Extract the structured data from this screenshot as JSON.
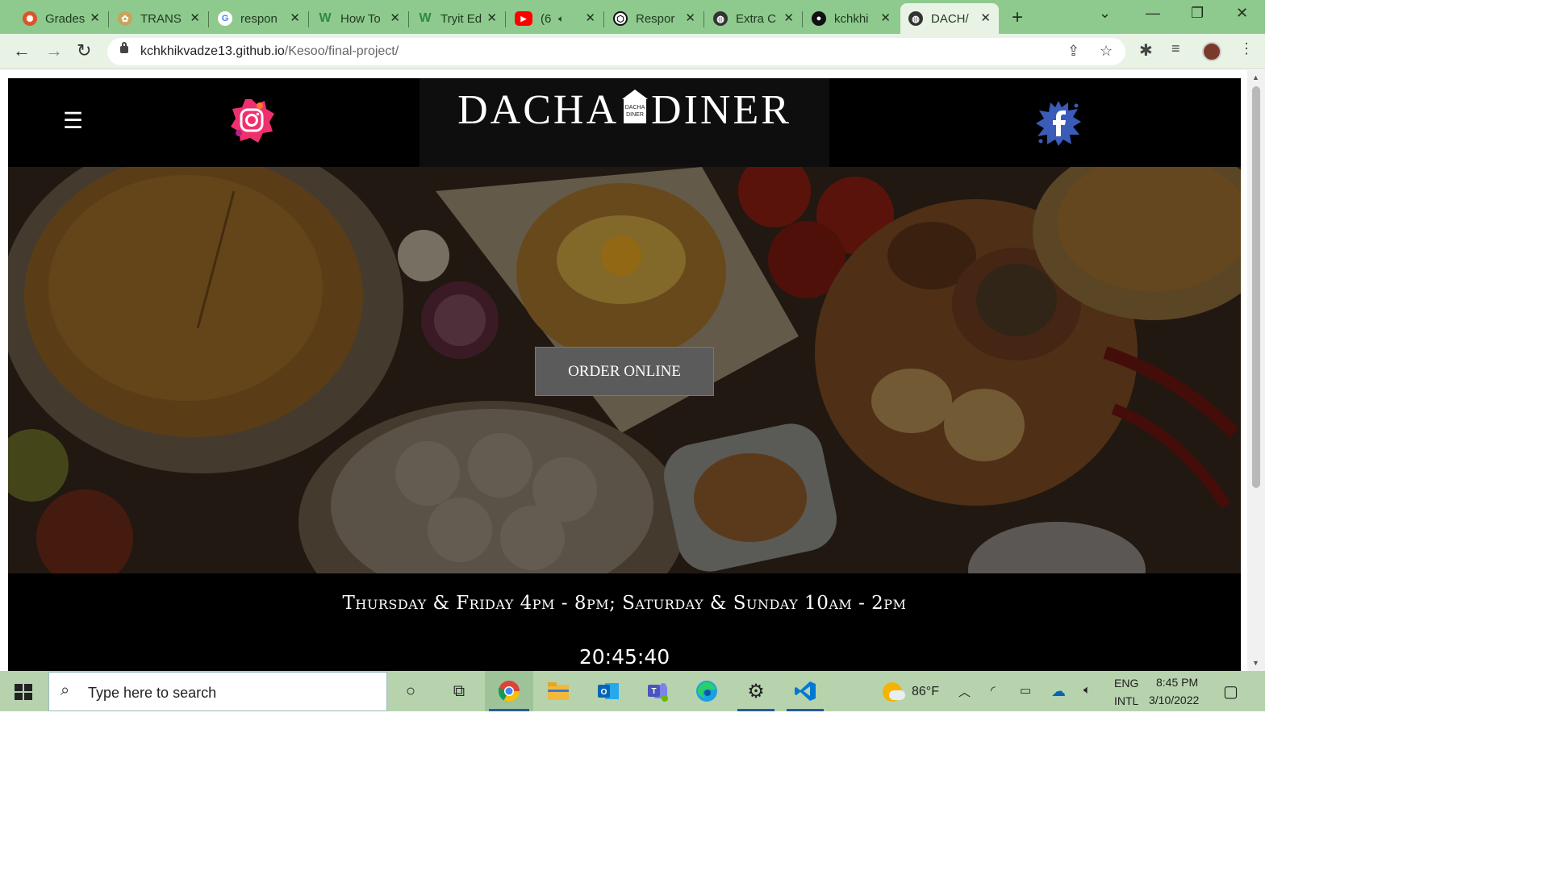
{
  "browser": {
    "tabs": [
      {
        "label": "Grades",
        "fav_color": "#d9552c",
        "fav_glyph": "✺"
      },
      {
        "label": "TRANS",
        "fav_color": "#c9a35a",
        "fav_glyph": "✿"
      },
      {
        "label": "respon",
        "fav_color": "#ffffff",
        "fav_glyph": "G"
      },
      {
        "label": "How To",
        "fav_color": "#2e8b3e",
        "fav_glyph": "W"
      },
      {
        "label": "Tryit Ed",
        "fav_color": "#2e8b3e",
        "fav_glyph": "W"
      },
      {
        "label": "(6",
        "fav_color": "#ff0000",
        "fav_glyph": "▶"
      },
      {
        "label": "Respor",
        "fav_color": "#111111",
        "fav_glyph": "⬡"
      },
      {
        "label": "Extra C",
        "fav_color": "#333333",
        "fav_glyph": "◍"
      },
      {
        "label": "kchkhi",
        "fav_color": "#111111",
        "fav_glyph": "●"
      },
      {
        "label": "DACH/",
        "fav_color": "#333333",
        "fav_glyph": "◍"
      }
    ],
    "address": {
      "host": "kchkhikvadze13.github.io",
      "path": "/Kesoo/final-project/"
    }
  },
  "site": {
    "logo_left": "DACHA",
    "logo_badge": "DACHA DINER",
    "logo_right": "DINER",
    "order_button": "ORDER ONLINE",
    "hours": "Thursday & Friday 4pm - 8pm; Saturday & Sunday 10am - 2pm",
    "clock": "20:45:40"
  },
  "taskbar": {
    "search_placeholder": "Type here to search",
    "weather_temp": "86°F",
    "lang_top": "ENG",
    "lang_bottom": "INTL",
    "time": "8:45 PM",
    "date": "3/10/2022"
  },
  "colors": {
    "tabbar": "#8ec98e",
    "toolbar": "#e8f3e5",
    "site_bg": "#000000",
    "button_bg": "#5b5b5b",
    "taskbar": "#b6d3ae"
  }
}
